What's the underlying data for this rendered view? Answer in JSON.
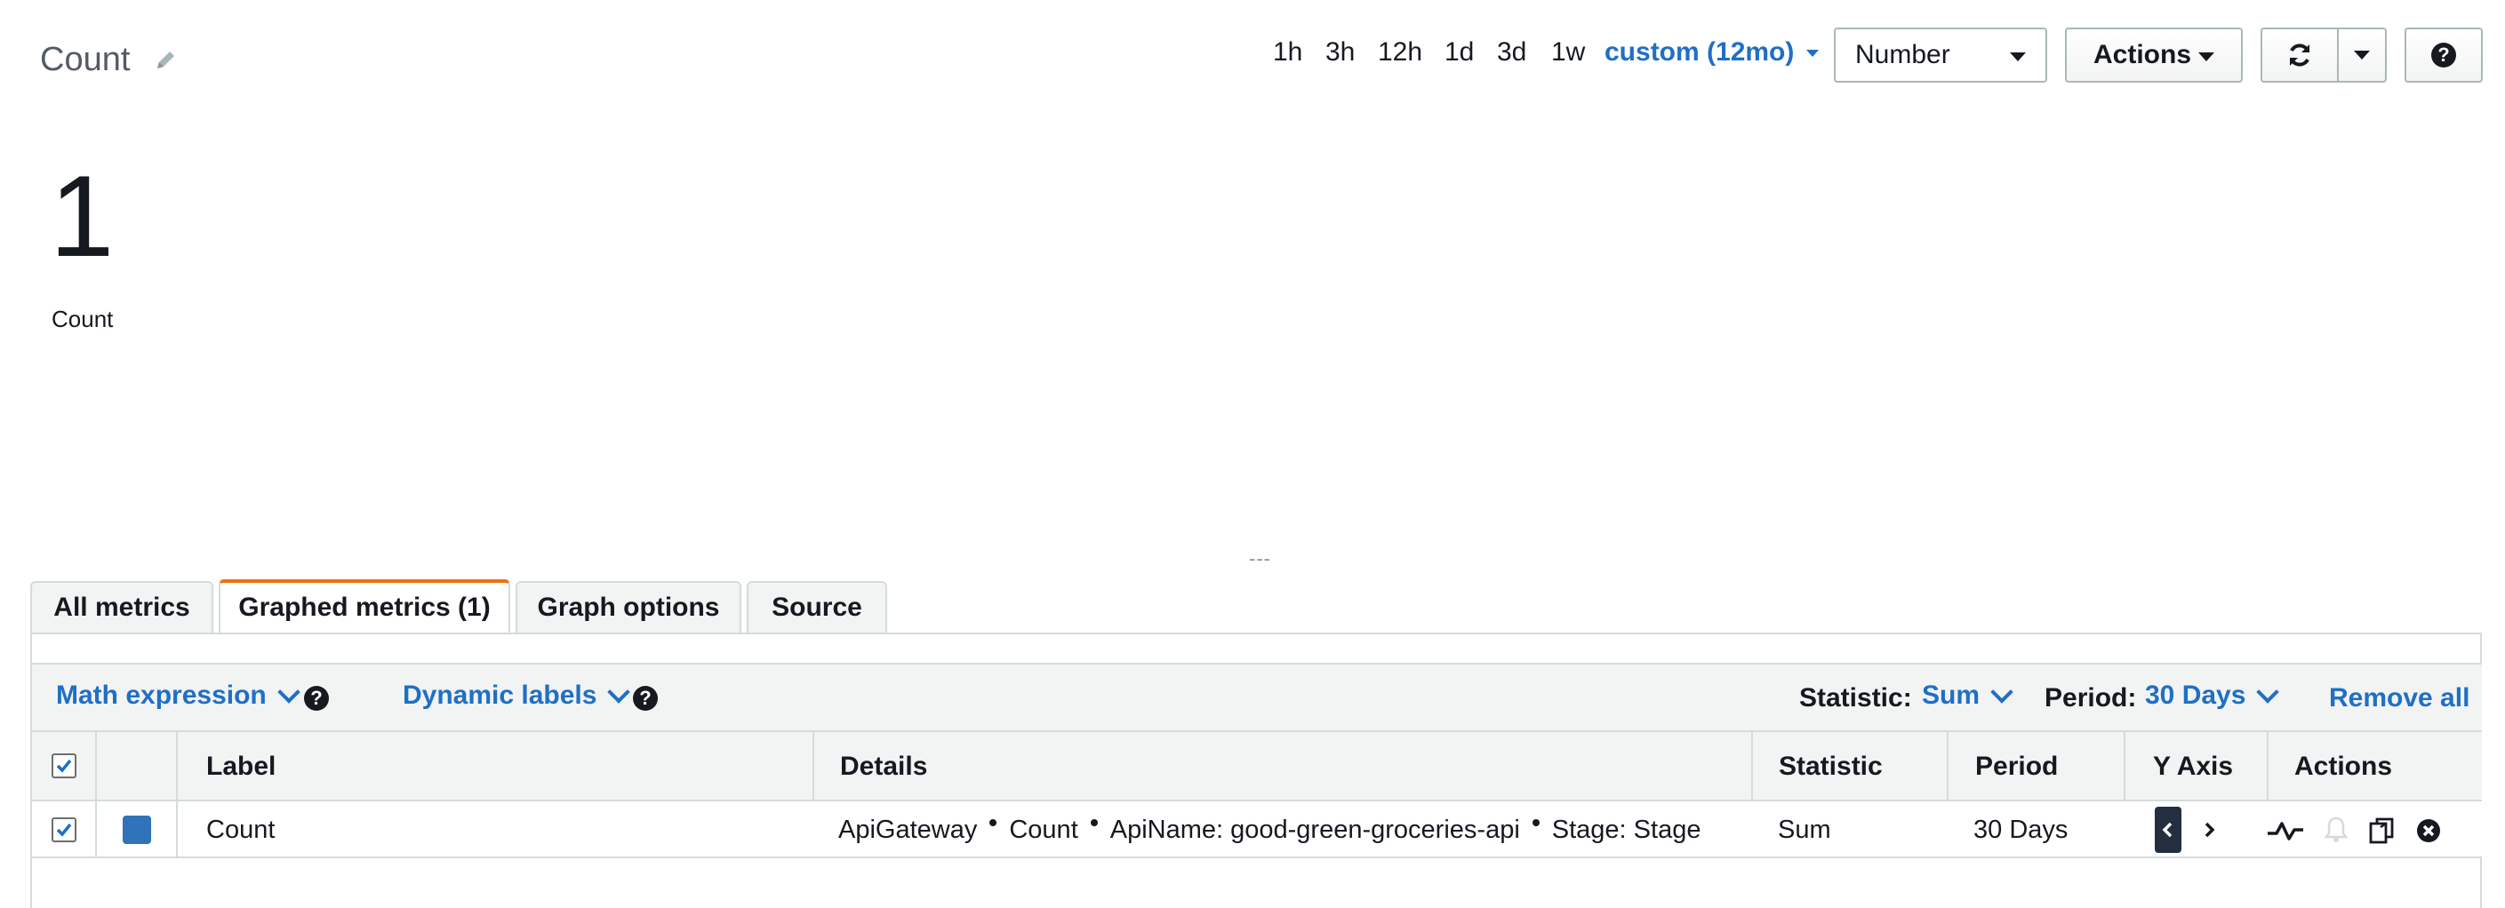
{
  "header": {
    "title": "Count",
    "time_ranges": [
      "1h",
      "3h",
      "12h",
      "1d",
      "3d",
      "1w"
    ],
    "custom_range": "custom (12mo)",
    "view_select": "Number",
    "actions_label": "Actions"
  },
  "widget": {
    "value": "1",
    "label": "Count",
    "resize_handle": "---"
  },
  "tabs": [
    {
      "label": "All metrics"
    },
    {
      "label": "Graphed metrics (1)"
    },
    {
      "label": "Graph options"
    },
    {
      "label": "Source"
    }
  ],
  "toolbar": {
    "math_expression": "Math expression",
    "dynamic_labels": "Dynamic labels",
    "statistic_label": "Statistic:",
    "statistic_value": "Sum",
    "period_label": "Period:",
    "period_value": "30 Days",
    "remove_all": "Remove all"
  },
  "table": {
    "headers": {
      "label": "Label",
      "details": "Details",
      "statistic": "Statistic",
      "period": "Period",
      "y_axis": "Y Axis",
      "actions": "Actions"
    },
    "rows": [
      {
        "color": "#3173b8",
        "label": "Count",
        "details": [
          "ApiGateway",
          "Count",
          "ApiName: good-green-groceries-api",
          "Stage: Stage"
        ],
        "statistic": "Sum",
        "period": "30 Days",
        "checked": true
      }
    ]
  },
  "colors": {
    "accent_link": "#1f6fc5",
    "active_tab_border": "#ec7211",
    "series_color": "#3173b8"
  }
}
